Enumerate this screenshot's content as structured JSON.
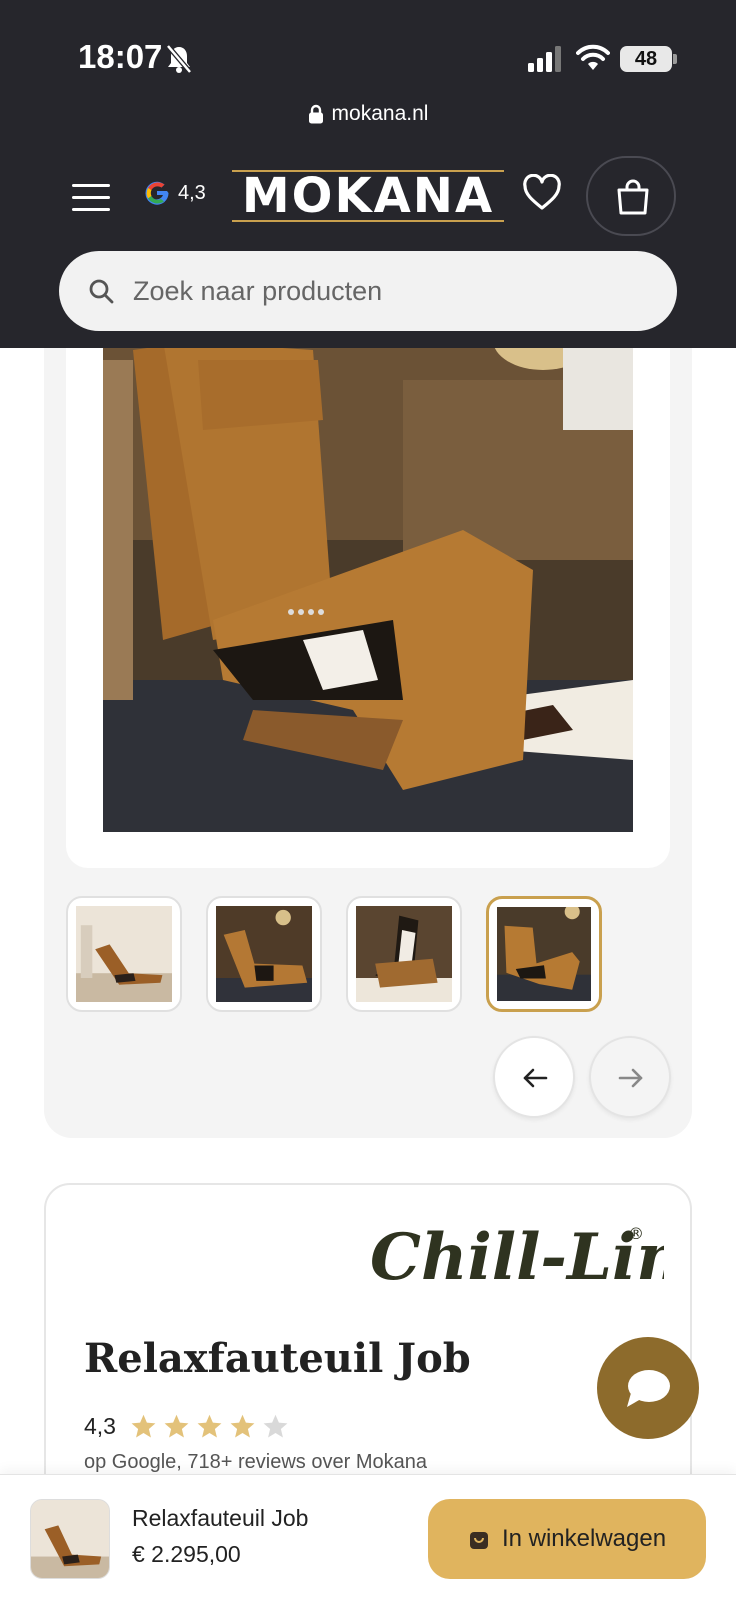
{
  "status_bar": {
    "time": "18:07",
    "battery": "48"
  },
  "browser": {
    "url": "mokana.nl"
  },
  "header": {
    "google_rating": "4,3",
    "logo_text": "MOKANA",
    "search_placeholder": "Zoek naar producten"
  },
  "gallery": {
    "thumbnail_count": 4,
    "active_thumbnail": 4
  },
  "product": {
    "brand": "Chill-Line",
    "title": "Relaxfauteuil Job",
    "rating_value": "4,3",
    "stars_filled": 4,
    "stars_total": 5,
    "review_text": "op Google, 718+ reviews over Mokana"
  },
  "sticky_bar": {
    "name": "Relaxfauteuil Job",
    "price": "€ 2.295,00",
    "add_to_cart_label": "In winkelwagen"
  },
  "colors": {
    "header_bg": "#26262c",
    "accent_gold": "#c9a04e",
    "button_gold": "#e0b45e",
    "chat_brown": "#8d6b2c",
    "star_gold": "#e3c27a",
    "brand_dark": "#2f3320"
  }
}
